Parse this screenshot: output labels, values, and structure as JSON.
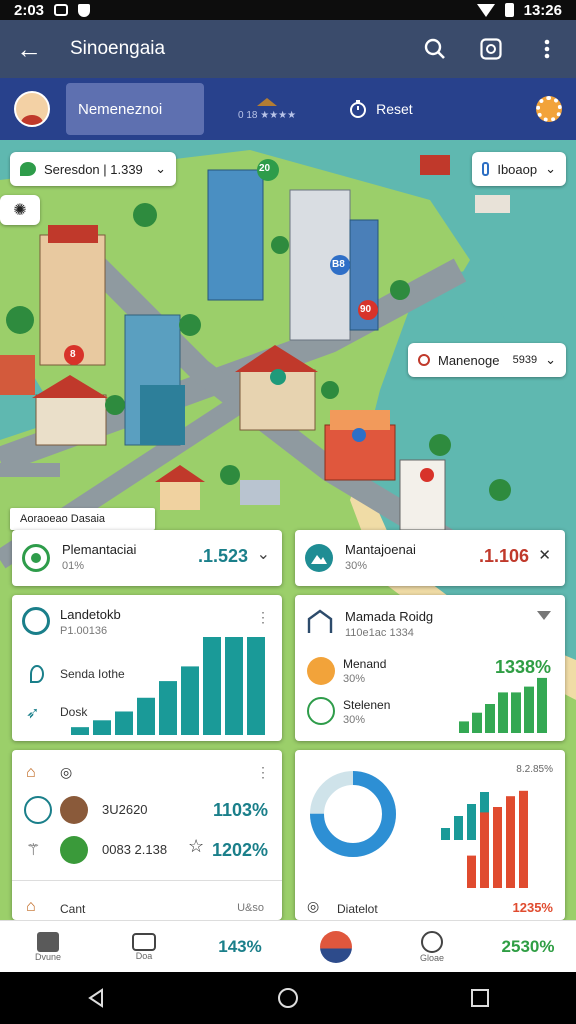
{
  "status_bar": {
    "time": "2:03",
    "right_time": "13:26"
  },
  "app_bar": {
    "title": "Sinoengaia"
  },
  "sub_header": {
    "tab_label": "Nemeneznoi",
    "rating_text": "0 18 ★★★★",
    "reset_label": "Reset"
  },
  "map": {
    "chips": {
      "top_left": "Seresdon | 1.339",
      "top_right": "Iboaop",
      "right": "Manenoge",
      "right_value": "5939",
      "cards_header": "Aoraoeao Dasaia"
    },
    "pins": [
      "20",
      "B8",
      "90",
      "8"
    ]
  },
  "cards": {
    "c1": {
      "title": "Plemantaciai",
      "sub": "01%",
      "value": ".1.523"
    },
    "c2": {
      "title": "Mantajoenai",
      "sub": "30%",
      "value": ".1.106"
    },
    "c3": {
      "title": "Landetokb",
      "sub": "P1.00136",
      "row1": "Senda Iothe",
      "row2": "Dosk",
      "bars": [
        8,
        15,
        24,
        38,
        55,
        70,
        100,
        100,
        100
      ]
    },
    "c4": {
      "title": "Mamada Roidg",
      "sub": "110e1ac 1334",
      "row1_title": "Menand",
      "row1_sub": "30%",
      "row2_title": "Stelenen",
      "row2_sub": "30%",
      "value": "1338%",
      "bars": [
        20,
        35,
        50,
        70,
        70,
        80,
        95
      ]
    },
    "c5": {
      "row1_text": "3U2620",
      "row1_value": "1103%",
      "row2_text": "0083 2.138",
      "row2_value": "1202%",
      "footer_label": "Cant",
      "footer_value": "U&so"
    },
    "c6": {
      "value": "8.2.85%",
      "donut_fraction": 0.75,
      "bars_blue": [
        20,
        40,
        60,
        80
      ],
      "bars_red": [
        30,
        70,
        75,
        85,
        90
      ],
      "footer_label": "Diatelot",
      "footer_value": "1235%"
    }
  },
  "bottom_nav": [
    {
      "label": "Dvune",
      "value": ""
    },
    {
      "label": "Doa",
      "value": ""
    },
    {
      "label": "",
      "value": "143%"
    },
    {
      "label": "",
      "value": ""
    },
    {
      "label": "Gloae",
      "value": ""
    },
    {
      "label": "",
      "value": "2530%"
    }
  ],
  "colors": {
    "appbar": "#3a4b6b",
    "subbar": "#28418c",
    "teal": "#1a9a98",
    "red": "#e04b2f",
    "green": "#34a853",
    "blue": "#2d8fd4"
  }
}
